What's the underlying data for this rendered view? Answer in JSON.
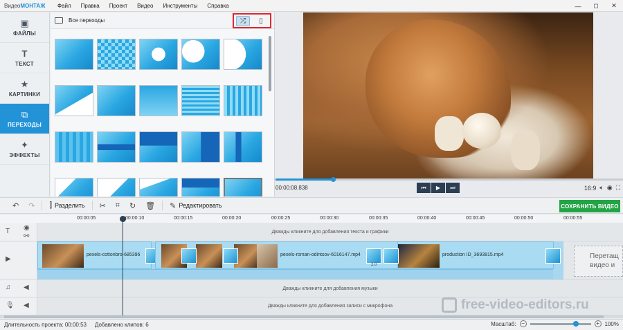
{
  "app": {
    "logo_prefix": "Видео",
    "logo_brand": "МОНТАЖ",
    "menu": [
      "Файл",
      "Правка",
      "Проект",
      "Видео",
      "Инструменты",
      "Справка"
    ],
    "window_controls": [
      "—",
      "◻",
      "✕"
    ]
  },
  "sidebar": {
    "items": [
      {
        "label": "ФАЙЛЫ",
        "icon": "image-icon",
        "glyph": "▣",
        "active": false
      },
      {
        "label": "ТЕКСТ",
        "icon": "text-icon",
        "glyph": "T",
        "active": false
      },
      {
        "label": "КАРТИНКИ",
        "icon": "star-icon",
        "glyph": "★",
        "active": false
      },
      {
        "label": "ПЕРЕХОДЫ",
        "icon": "transitions-icon",
        "glyph": "⧉",
        "active": true
      },
      {
        "label": "ЭФФЕКТЫ",
        "icon": "magic-wand-icon",
        "glyph": "✦",
        "active": false
      }
    ]
  },
  "transitions": {
    "title": "Все переходы",
    "shuffle_glyph": "⤮",
    "apply_all_glyph": "▯"
  },
  "preview": {
    "time": "00:00:08.838",
    "aspect": "16:9",
    "controls": [
      "⏮",
      "▶",
      "⏭"
    ],
    "playback_progress": 0.168
  },
  "toolbar": {
    "undo": "↶",
    "redo": "↷",
    "split_label": "Разделить",
    "edit_label": "Редактировать",
    "save_label": "СОХРАНИТЬ ВИДЕО"
  },
  "timeline": {
    "ruler": [
      "00:00:05",
      "00:00:10",
      "00:00:15",
      "00:00:20",
      "00:00:25",
      "00:00:30",
      "00:00:35",
      "00:00:40",
      "00:00:45",
      "00:00:50",
      "00:00:55"
    ],
    "text_hint": "Дважды кликните для добавления текста и графики",
    "music_hint": "Дважды кликните для добавления музыки",
    "mic_hint": "Дважды кликните для добавления записи с микрофона",
    "clips": [
      "pexels-cottonbro-685396",
      "pexels-roman-odintsov-6016147.mp4",
      "production ID_3693815.mp4"
    ],
    "transition_duration": "2.0",
    "dropzone_line1": "Перетащ",
    "dropzone_line2": "видео и"
  },
  "status": {
    "duration_label": "Длительность проекта:",
    "duration": "00:00:53",
    "clips_label": "Добавлено клипов:",
    "clips": "6",
    "zoom_label": "Масштаб:",
    "zoom": "100%"
  },
  "watermark": "free-video-editors.ru"
}
